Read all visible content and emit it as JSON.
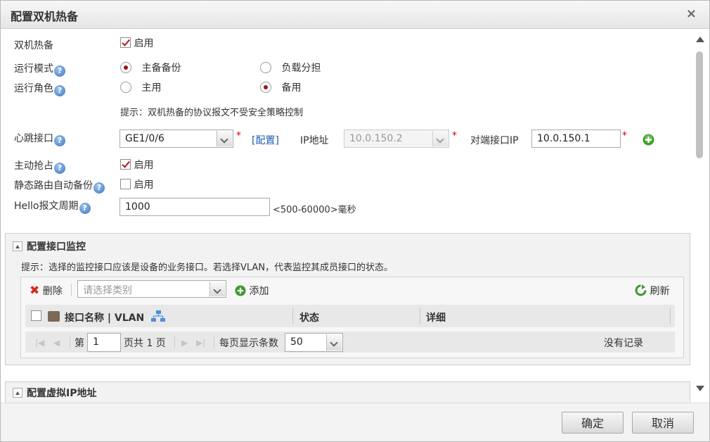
{
  "dialog": {
    "title": "配置双机热备",
    "close_label": "×"
  },
  "form": {
    "hot_standby": {
      "label": "双机热备",
      "checkbox_label": "启用",
      "checked": true
    },
    "run_mode": {
      "label": "运行模式",
      "options": [
        "主备备份",
        "负载分担"
      ],
      "selected": "主备备份"
    },
    "run_role": {
      "label": "运行角色",
      "options": [
        "主用",
        "备用"
      ],
      "selected": "备用"
    },
    "tip": "提示：双机热备的协议报文不受安全策略控制",
    "heartbeat": {
      "label": "心跳接口",
      "value": "GE1/0/6",
      "config_link": "[配置]",
      "ip_label": "IP地址",
      "ip_value": "10.0.150.2",
      "peer_ip_label": "对端接口IP",
      "peer_ip_value": "10.0.150.1",
      "required_mark": "*"
    },
    "preempt": {
      "label": "主动抢占",
      "checkbox_label": "启用",
      "checked": true
    },
    "static_route": {
      "label": "静态路由自动备份",
      "checkbox_label": "启用",
      "checked": false
    },
    "hello": {
      "label": "Hello报文周期",
      "value": "1000",
      "range_text": "<500-60000>毫秒"
    }
  },
  "monitor_panel": {
    "title": "配置接口监控",
    "tip": "提示：选择的监控接口应该是设备的业务接口。若选择VLAN，代表监控其成员接口的状态。",
    "toolbar": {
      "delete_label": "删除",
      "category_placeholder": "请选择类别",
      "add_label": "添加",
      "refresh_label": "刷新"
    },
    "columns": [
      "接口名称 | VLAN",
      "状态",
      "详细"
    ],
    "pager": {
      "page_prefix": "第",
      "page_value": "1",
      "page_suffix": "页共 1 页",
      "per_page_label": "每页显示条数",
      "per_page_value": "50",
      "empty_text": "没有记录"
    }
  },
  "vip_panel": {
    "title": "配置虚拟IP地址"
  },
  "footer": {
    "ok_label": "确定",
    "cancel_label": "取消"
  },
  "icons": {
    "help": "help-icon",
    "delete": "delete-icon",
    "add": "add-icon",
    "refresh": "refresh-icon",
    "interface": "interface-icon",
    "network": "network-icon"
  },
  "colors": {
    "accent_link": "#1f5bb5",
    "required": "#dd0000",
    "check_mark": "#b01818"
  }
}
